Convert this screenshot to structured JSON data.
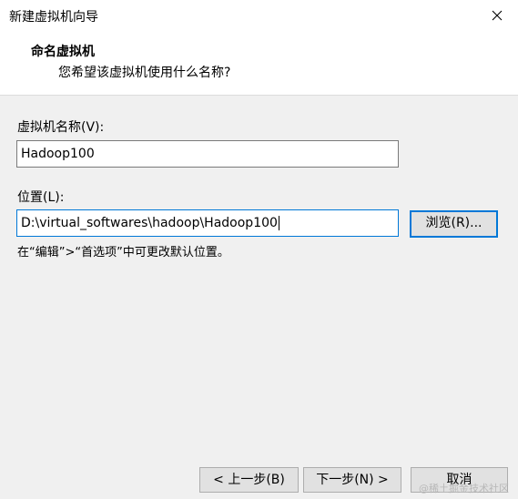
{
  "window": {
    "title": "新建虚拟机向导"
  },
  "header": {
    "title": "命名虚拟机",
    "subtitle": "您希望该虚拟机使用什么名称?"
  },
  "form": {
    "name_label": "虚拟机名称(V):",
    "name_value": "Hadoop100",
    "location_label": "位置(L):",
    "location_value": "D:\\virtual_softwares\\hadoop\\Hadoop100",
    "browse_label": "浏览(R)...",
    "hint": "在“编辑”>“首选项”中可更改默认位置。"
  },
  "footer": {
    "back_label": "< 上一步(B)",
    "next_label": "下一步(N) >",
    "cancel_label": "取消"
  },
  "watermark": "@稀土掘金技术社区",
  "colors": {
    "focus": "#0078d7",
    "panel": "#f0f0f0",
    "button": "#e1e1e1"
  }
}
